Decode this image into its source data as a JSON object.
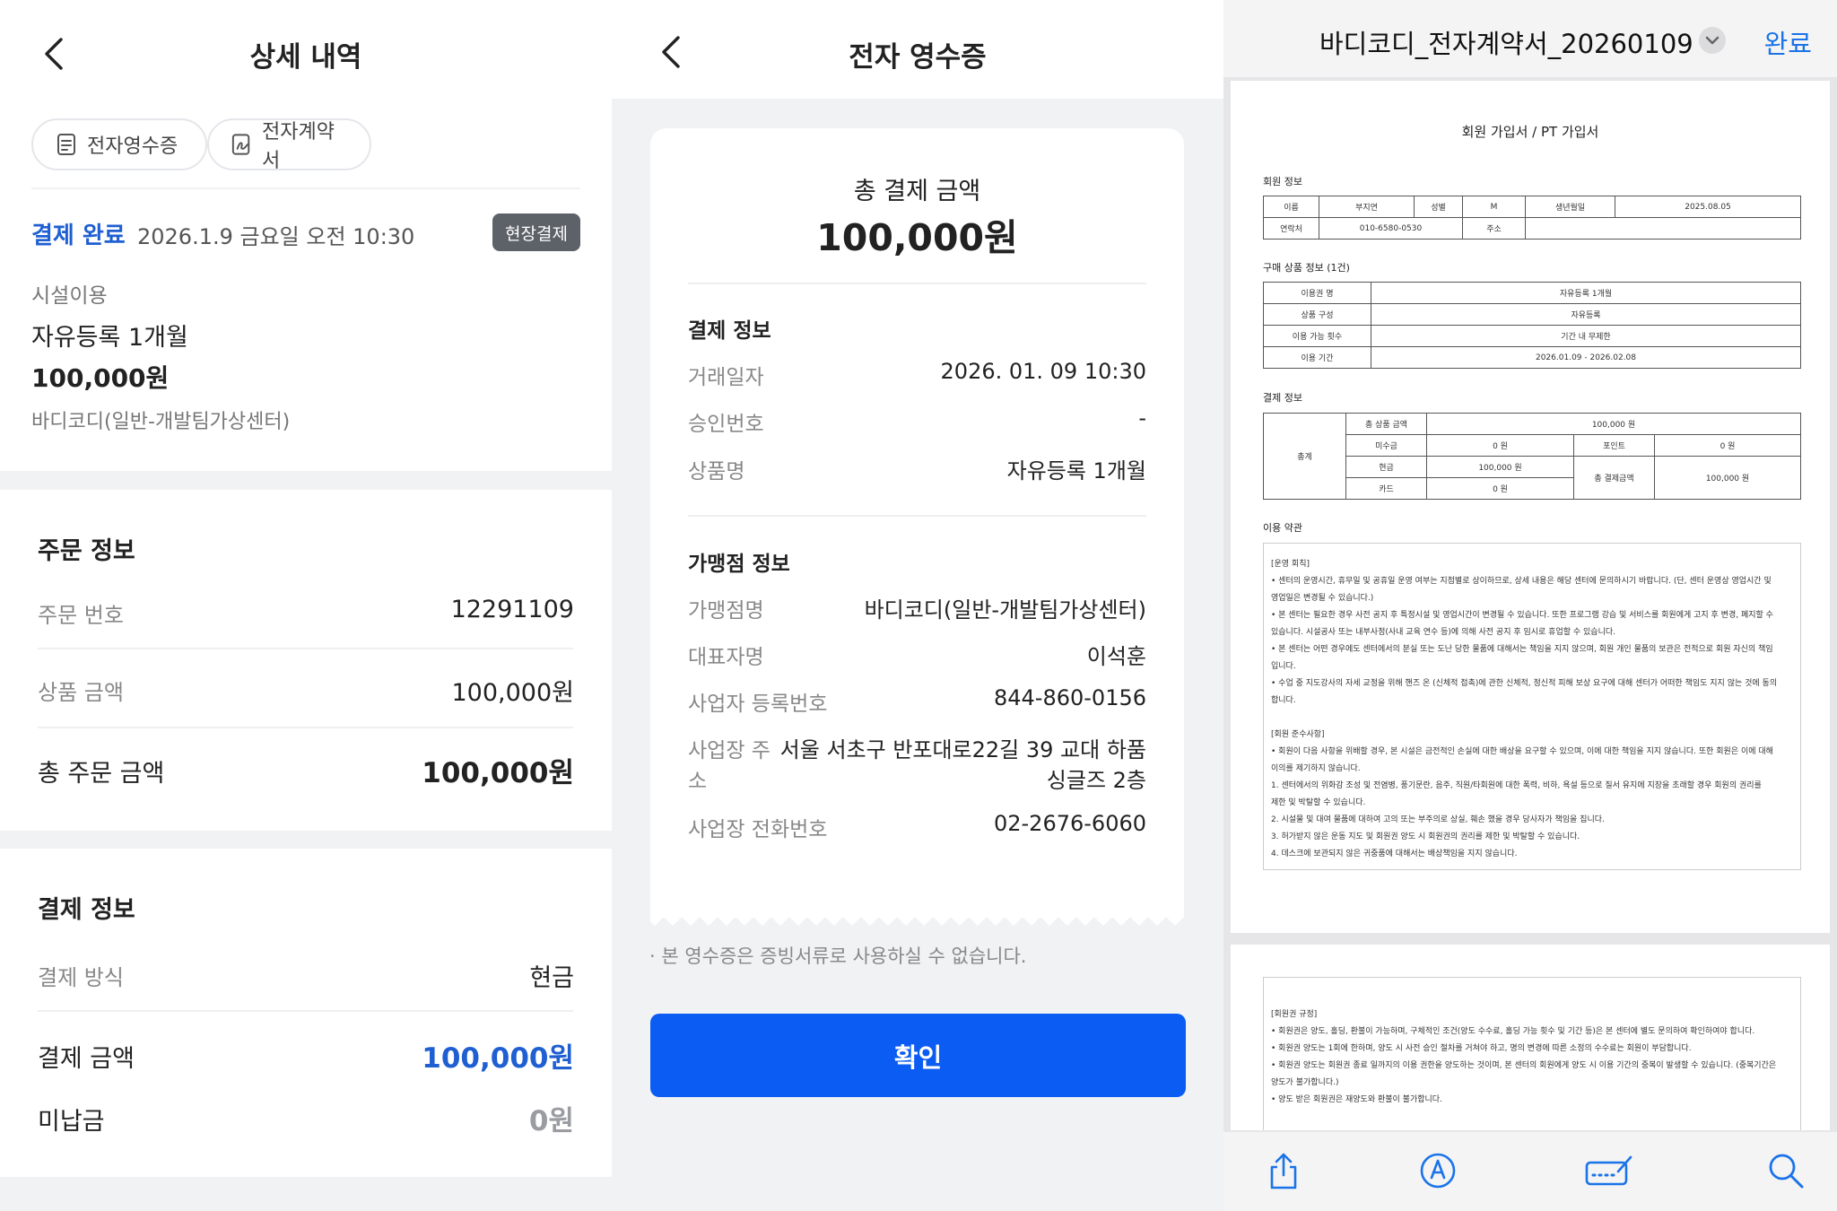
{
  "detail": {
    "title": "상세 내역",
    "chips": {
      "receipt": "전자영수증",
      "contract": "전자계약서"
    },
    "status": "결제 완료",
    "date": "2026.1.9 금요일 오전 10:30",
    "badge": "현장결제",
    "category": "시설이용",
    "product": "자유등록 1개월",
    "price": "100,000원",
    "center": "바디코디(일반-개발팀가상센터)",
    "order": {
      "title": "주문 정보",
      "number_label": "주문 번호",
      "number": "12291109",
      "amount_label": "상품 금액",
      "amount": "100,000원",
      "total_label": "총 주문 금액",
      "total": "100,000원"
    },
    "payment": {
      "title": "결제 정보",
      "method_label": "결제 방식",
      "method": "현금",
      "amount_label": "결제 금액",
      "amount": "100,000원",
      "unpaid_label": "미납금",
      "unpaid": "0원"
    }
  },
  "receipt": {
    "title": "전자 영수증",
    "total_label": "총 결제 금액",
    "total": "100,000원",
    "payment_title": "결제 정보",
    "payment_rows": [
      {
        "label": "거래일자",
        "value": "2026. 01. 09 10:30"
      },
      {
        "label": "승인번호",
        "value": "-"
      },
      {
        "label": "상품명",
        "value": "자유등록 1개월"
      }
    ],
    "merchant_title": "가맹점 정보",
    "merchant_rows": [
      {
        "label": "가맹점명",
        "value": "바디코디(일반-개발팀가상센터)"
      },
      {
        "label": "대표자명",
        "value": "이석훈"
      },
      {
        "label": "사업자 등록번호",
        "value": "844-860-0156"
      },
      {
        "label_l1": "사업장 주",
        "label_l2": "소",
        "value_l1": "서울 서초구 반포대로22길 39 교대 하품",
        "value_l2": "싱글즈 2층"
      },
      {
        "label": "사업장 전화번호",
        "value": "02-2676-6060"
      }
    ],
    "note": "· 본 영수증은 증빙서류로 사용하실 수 없습니다.",
    "confirm": "확인"
  },
  "contract": {
    "file_title": "바디코디_전자계약서_20260109",
    "done": "완료",
    "doc_title": "회원 가입서 / PT 가입서",
    "member_title": "회원 정보",
    "member": {
      "name_label": "이름",
      "name": "부지연",
      "gender_label": "성별",
      "gender": "M",
      "birth_label": "생년월일",
      "birth": "2025.08.05",
      "phone_label": "연락처",
      "phone": "010-6580-0530",
      "address_label": "주소"
    },
    "purchase_title": "구매 상품 정보 (1건)",
    "purchase_rows": [
      {
        "label": "이용권 명",
        "value": "자유등록 1개월"
      },
      {
        "label": "상품 구성",
        "value": "자유등록"
      },
      {
        "label": "이용 가능 횟수",
        "value": "기간 내 무제한"
      },
      {
        "label": "이용 기간",
        "value": "2026.01.09 - 2026.02.08"
      }
    ],
    "pay_title": "결제 정보",
    "pay": {
      "total_label": "총계",
      "product_total_label": "총 상품 금액",
      "product_total": "100,000 원",
      "unpaid_label": "미수금",
      "unpaid": "0 원",
      "point_label": "포인트",
      "point": "0 원",
      "cash_label": "현금",
      "cash": "100,000 원",
      "card_label": "카드",
      "card": "0 원",
      "paid_total_label": "총 결제금액",
      "paid_total": "100,000 원"
    },
    "terms_title": "이용 약관",
    "terms": [
      "[운영 회칙]",
      "• 센터의 운영시간, 휴무일 및 공휴일 운영 여부는 지점별로 상이하므로, 상세 내용은 해당 센터에 문의하시기 바랍니다. (단, 센터 운영상 영업시간 및",
      "영업일은 변경될 수 있습니다.)",
      "• 본 센터는 필요한 경우 사전 공지 후 특정시설 및 영업시간이 변경될 수 있습니다. 또한 프로그램 강습 및 서비스를 회원에게 고지 후 변경, 폐지할 수",
      "있습니다. 시설공사 또는 내부사정(사내 교육 연수 등)에 의해 사전 공지 후 임시로 휴업할 수 있습니다.",
      "• 본 센터는 어떤 경우에도 센터에서의 분실 또는 도난 당한 물품에 대해서는 책임을 지지 않으며, 회원 개인 물품의 보관은 전적으로 회원 자신의 책임",
      "입니다.",
      "• 수업 중 지도강사의 자세 교정을 위해 핸즈 온 (신체적 접촉)에 관한 신체적, 정신적 피해 보상 요구에 대해 센터가 어떠한 책임도 지지 않는 것에 동의",
      "합니다.",
      "",
      "[회원 준수사항]",
      "• 회원이 다음 사항을 위배할 경우, 본 시설은 금전적인 손실에 대한 배상을 요구할 수 있으며, 이에 대한 책임을 지지 않습니다. 또한 회원은 이에 대해",
      "이의를 제기하지 않습니다.",
      "   1. 센터에서의 위화감 조성 및 전염병, 풍기문란, 음주, 직원/타회원에 대한 폭력, 비하, 욕설 등으로 질서 유지에 지장을 초래할 경우 회원의 권리를",
      "제한 및 박탈할 수 있습니다.",
      "   2. 시설물 및 대여 물품에 대하여 고의 또는 부주의로 상실, 훼손 했을 경우 당사자가 책임을 집니다.",
      "   3. 허가받지 않은 운동 지도 및 회원권 양도 시 회원권의 권리를 제한 및 박탈할 수 있습니다.",
      "   4. 데스크에 보관되지 않은 귀중품에 대해서는 배상책임을 지지 않습니다."
    ],
    "terms2": [
      "[회원권 규정]",
      "• 회원권은 양도, 홀딩, 환불이 가능하며, 구체적인 조건(양도 수수료, 홀딩 가능 횟수 및 기간 등)은 본 센터에 별도 문의하여 확인하여야 합니다.",
      "• 회원권 양도는 1회에 한하며, 양도 시 사전 승인 절차를 거쳐야 하고, 명의 변경에 따른 소정의 수수료는 회원이 부담합니다.",
      "• 회원권 양도는 회원권 종료 일까지의 이용 권한을 양도하는 것이며, 본 센터의 회원에게 양도 시 이용 기간의 중복이 발생할 수 있습니다. (중복기간은",
      "양도가 불가합니다.)",
      "• 양도 받은 회원권은 재양도와 환불이 불가합니다."
    ]
  },
  "colors": {
    "accent_blue": "#1f5fd1",
    "button_blue": "#0b5cf2",
    "badge_gray": "#5d6168",
    "ios_blue": "#1a73e8"
  }
}
